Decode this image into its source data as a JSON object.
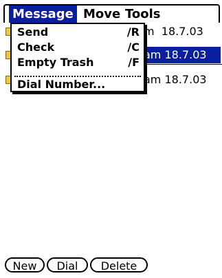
{
  "menubar": {
    "menus": [
      {
        "label": "Message",
        "active": true
      },
      {
        "label": "Move",
        "active": false
      },
      {
        "label": "Tools",
        "active": false
      }
    ]
  },
  "dropdown": {
    "items": [
      {
        "label": "Send",
        "shortcut": "∕R"
      },
      {
        "label": "Check",
        "shortcut": "∕C"
      },
      {
        "label": "Empty Trash",
        "shortcut": "∕F"
      },
      {
        "label": "Dial Number...",
        "shortcut": ""
      }
    ]
  },
  "list": {
    "rows": [
      {
        "when": "m  18.7.03",
        "selected": false
      },
      {
        "when": "am 18.7.03",
        "selected": true
      },
      {
        "when": "am 18.7.03",
        "selected": false
      }
    ]
  },
  "buttons": {
    "new_label": "New",
    "dial_label": "Dial",
    "delete_label": "Delete"
  },
  "colors": {
    "selection": "#0a1ea0",
    "icon": "#e6c84a"
  }
}
